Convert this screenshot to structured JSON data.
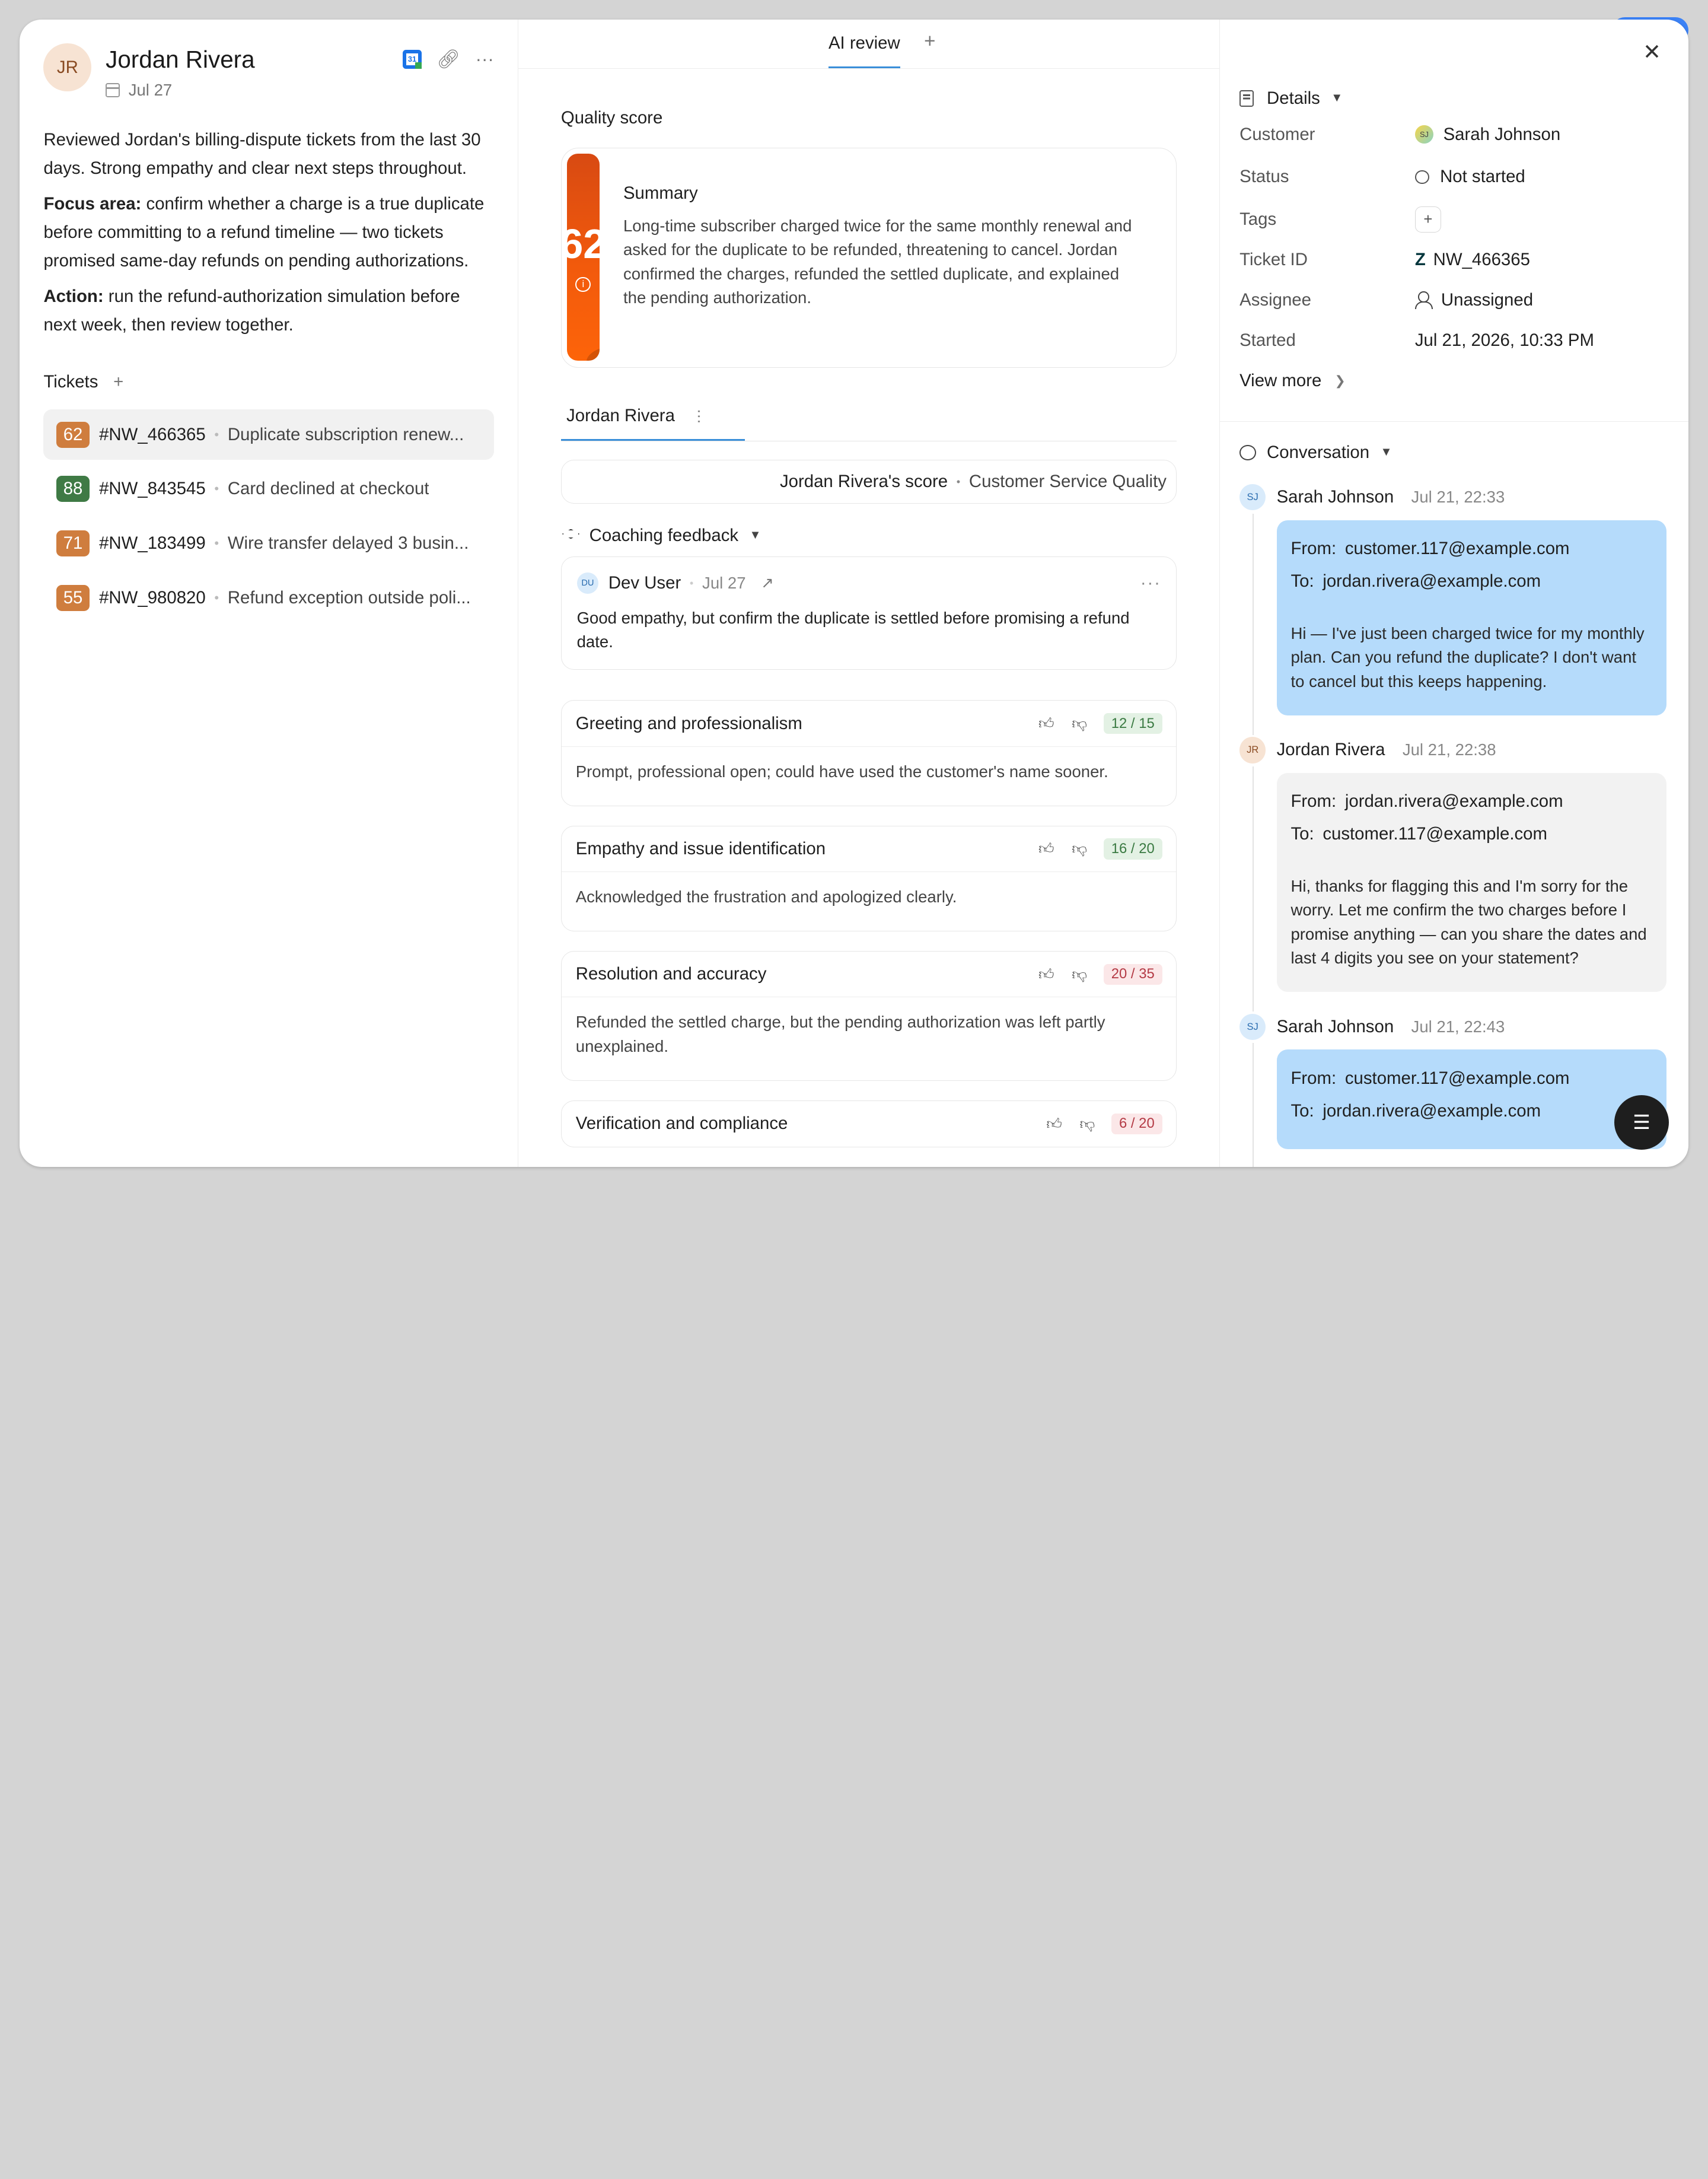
{
  "person": {
    "initials": "JR",
    "name": "Jordan Rivera",
    "date": "Jul 27"
  },
  "notes": {
    "intro": "Reviewed Jordan's billing-dispute tickets from the last 30 days. Strong empathy and clear next steps throughout.",
    "focus_label": "Focus area:",
    "focus_text": " confirm whether a charge is a true duplicate before committing to a refund timeline — two tickets promised same-day refunds on pending authorizations.",
    "action_label": "Action:",
    "action_text": " run the refund-authorization simulation before next week, then review together."
  },
  "tickets": {
    "label": "Tickets",
    "plus": "+",
    "items": [
      {
        "score": "62",
        "color": "#cf7d3e",
        "id": "#NW_466365",
        "title": "Duplicate subscription renew..."
      },
      {
        "score": "88",
        "color": "#3f7a45",
        "id": "#NW_843545",
        "title": "Card declined at checkout"
      },
      {
        "score": "71",
        "color": "#cf7d3e",
        "id": "#NW_183499",
        "title": "Wire transfer delayed 3 busin..."
      },
      {
        "score": "55",
        "color": "#cf7d3e",
        "id": "#NW_980820",
        "title": "Refund exception outside poli..."
      }
    ]
  },
  "tabs": {
    "active": "AI review",
    "plus": "+"
  },
  "quality": {
    "label": "Quality score",
    "score": "62",
    "info": "i",
    "summary_title": "Summary",
    "summary_text": "Long-time subscriber charged twice for the same monthly renewal and asked for the duplicate to be refunded, threatening to cancel. Jordan confirmed the charges, refunded the settled duplicate, and explained the pending authorization."
  },
  "agent_tab": {
    "label": "Jordan Rivera",
    "menu": "⋯"
  },
  "score_row": {
    "score_label": "Jordan Rivera's score",
    "sep": "•",
    "rubric": "Customer Service Quality"
  },
  "coaching": {
    "label": "Coaching feedback",
    "caret": "▼",
    "author_initials": "DU",
    "author": "Dev User",
    "date": "Jul 27",
    "more": "···",
    "text": "Good empathy, but confirm the duplicate is settled before promising a refund date."
  },
  "criteria": [
    {
      "title": "Greeting and professionalism",
      "score": "12 / 15",
      "tone": "good",
      "text": "Prompt, professional open; could have used the customer's name sooner."
    },
    {
      "title": "Empathy and issue identification",
      "score": "16 / 20",
      "tone": "good",
      "text": "Acknowledged the frustration and apologized clearly."
    },
    {
      "title": "Resolution and accuracy",
      "score": "20 / 35",
      "tone": "bad",
      "text": "Refunded the settled charge, but the pending authorization was left partly unexplained."
    },
    {
      "title": "Verification and compliance",
      "score": "6 / 20",
      "tone": "bad",
      "text": ""
    }
  ],
  "details": {
    "label": "Details",
    "caret": "▼",
    "customer_label": "Customer",
    "customer_initials": "SJ",
    "customer": "Sarah Johnson",
    "status_label": "Status",
    "status": "Not started",
    "tags_label": "Tags",
    "tags_plus": "+",
    "ticket_label": "Ticket ID",
    "ticket_id": "NW_466365",
    "assignee_label": "Assignee",
    "assignee": "Unassigned",
    "started_label": "Started",
    "started": "Jul 21, 2026, 10:33 PM",
    "view_more": "View more"
  },
  "conversation": {
    "label": "Conversation",
    "caret": "▼",
    "from_label": "From:",
    "to_label": "To:",
    "messages": [
      {
        "initials": "SJ",
        "author": "Sarah Johnson",
        "time": "Jul 21, 22:33",
        "from": "customer.117@example.com",
        "to": "jordan.rivera@example.com",
        "text": "Hi — I've just been charged twice for my monthly plan. Can you refund the duplicate? I don't want to cancel but this keeps happening."
      },
      {
        "initials": "JR",
        "author": "Jordan Rivera",
        "time": "Jul 21, 22:38",
        "from": "jordan.rivera@example.com",
        "to": "customer.117@example.com",
        "text": "Hi, thanks for flagging this and I'm sorry for the worry. Let me confirm the two charges before I promise anything — can you share the dates and last 4 digits you see on your statement?"
      },
      {
        "initials": "SJ",
        "author": "Sarah Johnson",
        "time": "Jul 21, 22:43",
        "from": "customer.117@example.com",
        "to": "jordan.rivera@example.com",
        "text": ""
      }
    ]
  },
  "colors": {
    "accent": "#3a8fd9",
    "score_orange": "#f25a0c",
    "customer_bubble": "#b5dbfb",
    "agent_bubble": "#f2f2f2"
  }
}
